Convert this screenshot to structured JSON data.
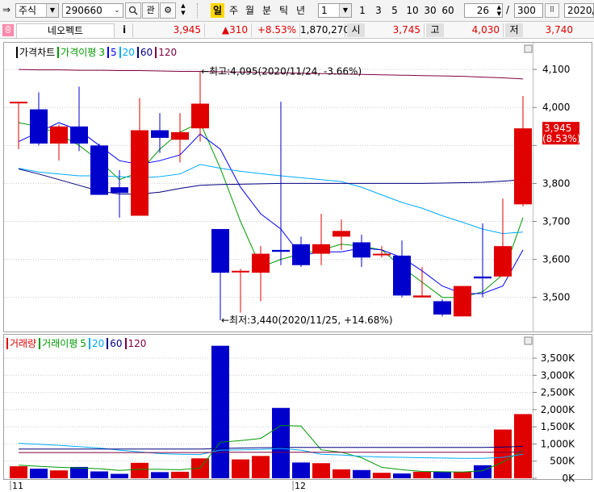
{
  "toolbar": {
    "market": "주식",
    "code": "290660",
    "watch_label": "관",
    "period_buttons": [
      "일",
      "주",
      "월",
      "분",
      "틱",
      "년"
    ],
    "interval_value": "1",
    "minute_buttons": [
      "1",
      "3",
      "5",
      "10",
      "30",
      "60"
    ],
    "count_value": "26",
    "slash": "/",
    "total_value": "300",
    "date_value": "2020/"
  },
  "info": {
    "stock_name": "네오펙트",
    "info_label": "i",
    "price": "3,945",
    "change": "▲310",
    "change_pct": "+8.53%",
    "volume": "1,870,270",
    "open_label": "시",
    "open": "3,745",
    "high_label": "고",
    "high": "4,030",
    "low_label": "저",
    "low": "3,740"
  },
  "price_legend": {
    "title": "가격차트",
    "ma_title": "가격이평",
    "ma_periods": [
      "3",
      "5",
      "20",
      "60",
      "120"
    ]
  },
  "volume_legend": {
    "title": "거래량",
    "ma_title": "거래이평",
    "ma_periods": [
      "5",
      "20",
      "60",
      "120"
    ]
  },
  "annotations": {
    "high": "←최고:4,095(2020/11/24, -3.66%)",
    "low": "←최저:3,440(2020/11/25, +14.68%)",
    "current_price": "3,945",
    "current_pct": "(8.53%)"
  },
  "x_labels": [
    {
      "label": "11",
      "index": 0
    },
    {
      "label": "12",
      "index": 14
    }
  ],
  "colors": {
    "up": "#e00000",
    "down": "#0000cc",
    "ma3": "#009900",
    "ma5": "#0000ff",
    "ma20": "#00aaff",
    "ma60": "#000080",
    "ma120": "#800040"
  },
  "chart_data": {
    "type": "candlestick",
    "price": {
      "ylim": [
        3440,
        4130
      ],
      "yticks": [
        3500,
        3600,
        3700,
        3800,
        3900,
        4000,
        4100
      ],
      "ytick_labels": [
        "3,500",
        "3,600",
        "3,700",
        "3,800",
        "",
        "4,000",
        "4,100"
      ],
      "candles": [
        {
          "o": 4015,
          "h": 4015,
          "l": 3890,
          "c": 4015
        },
        {
          "o": 3995,
          "h": 4040,
          "l": 3900,
          "c": 3905
        },
        {
          "o": 3905,
          "h": 3955,
          "l": 3860,
          "c": 3950
        },
        {
          "o": 3950,
          "h": 4055,
          "l": 3885,
          "c": 3905
        },
        {
          "o": 3900,
          "h": 3905,
          "l": 3770,
          "c": 3770
        },
        {
          "o": 3790,
          "h": 3835,
          "l": 3710,
          "c": 3775
        },
        {
          "o": 3715,
          "h": 4025,
          "l": 3715,
          "c": 3940
        },
        {
          "o": 3940,
          "h": 3985,
          "l": 3880,
          "c": 3920
        },
        {
          "o": 3915,
          "h": 3985,
          "l": 3855,
          "c": 3935
        },
        {
          "o": 3945,
          "h": 4095,
          "l": 3910,
          "c": 4010
        },
        {
          "o": 3680,
          "h": 3680,
          "l": 3440,
          "c": 3565
        },
        {
          "o": 3570,
          "h": 3575,
          "l": 3460,
          "c": 3570
        },
        {
          "o": 3565,
          "h": 3635,
          "l": 3490,
          "c": 3615
        },
        {
          "o": 3625,
          "h": 4015,
          "l": 3585,
          "c": 3620
        },
        {
          "o": 3640,
          "h": 3660,
          "l": 3580,
          "c": 3585
        },
        {
          "o": 3615,
          "h": 3720,
          "l": 3585,
          "c": 3640
        },
        {
          "o": 3660,
          "h": 3705,
          "l": 3625,
          "c": 3675
        },
        {
          "o": 3645,
          "h": 3665,
          "l": 3580,
          "c": 3605
        },
        {
          "o": 3615,
          "h": 3635,
          "l": 3605,
          "c": 3615
        },
        {
          "o": 3610,
          "h": 3650,
          "l": 3500,
          "c": 3505
        },
        {
          "o": 3500,
          "h": 3580,
          "l": 3500,
          "c": 3505
        },
        {
          "o": 3490,
          "h": 3495,
          "l": 3450,
          "c": 3455
        },
        {
          "o": 3450,
          "h": 3525,
          "l": 3450,
          "c": 3530
        },
        {
          "o": 3555,
          "h": 3695,
          "l": 3500,
          "c": 3550
        },
        {
          "o": 3555,
          "h": 3760,
          "l": 3555,
          "c": 3635
        },
        {
          "o": 3745,
          "h": 4030,
          "l": 3740,
          "c": 3945
        }
      ],
      "ma": [
        {
          "name": "3",
          "color": "#009900",
          "values": [
            3960,
            3950,
            3930,
            3900,
            3860,
            3810,
            3830,
            3890,
            3935,
            3960,
            3840,
            3700,
            3580,
            3600,
            3615,
            3625,
            3640,
            3635,
            3625,
            3580,
            3540,
            3500,
            3500,
            3515,
            3560,
            3710
          ]
        },
        {
          "name": "5",
          "color": "#0000ff",
          "values": [
            3910,
            3935,
            3960,
            3940,
            3900,
            3860,
            3850,
            3860,
            3875,
            3930,
            3890,
            3790,
            3720,
            3680,
            3610,
            3620,
            3620,
            3630,
            3625,
            3605,
            3570,
            3530,
            3510,
            3510,
            3530,
            3625
          ]
        },
        {
          "name": "20",
          "color": "#00aaff",
          "values": [
            3840,
            3830,
            3825,
            3820,
            3820,
            3818,
            3815,
            3818,
            3825,
            3850,
            3840,
            3832,
            3826,
            3820,
            3815,
            3810,
            3805,
            3790,
            3770,
            3750,
            3735,
            3715,
            3698,
            3680,
            3668,
            3672
          ]
        },
        {
          "name": "60",
          "color": "#000080",
          "values": [
            3838,
            3825,
            3810,
            3795,
            3780,
            3772,
            3772,
            3777,
            3787,
            3795,
            3797,
            3798,
            3799,
            3800,
            3800,
            3800,
            3800,
            3800,
            3800,
            3800,
            3800,
            3801,
            3802,
            3803,
            3806,
            3810
          ]
        },
        {
          "name": "120",
          "color": "#800040",
          "values": [
            4100,
            4099,
            4099,
            4098,
            4098,
            4097,
            4097,
            4096,
            4095,
            4095,
            4094,
            4093,
            4092,
            4091,
            4090,
            4089,
            4088,
            4087,
            4086,
            4085,
            4084,
            4083,
            4082,
            4080,
            4078,
            4075
          ]
        }
      ]
    },
    "volume": {
      "ylim": [
        0,
        3900000
      ],
      "yticks": [
        0,
        500000,
        1000000,
        1500000,
        2000000,
        2500000,
        3000000,
        3500000
      ],
      "ytick_labels": [
        "0K",
        "500K",
        "1,000K",
        "1,500K",
        "2,000K",
        "2,500K",
        "3,000K",
        "3,500K"
      ],
      "values": [
        350000,
        280000,
        230000,
        330000,
        200000,
        130000,
        450000,
        180000,
        190000,
        580000,
        3860000,
        550000,
        650000,
        2050000,
        460000,
        440000,
        260000,
        240000,
        160000,
        140000,
        190000,
        190000,
        190000,
        380000,
        1420000,
        1870000
      ],
      "ma": [
        {
          "name": "5",
          "color": "#009900",
          "values": [
            380000,
            350000,
            320000,
            300000,
            280000,
            230000,
            260000,
            260000,
            250000,
            300000,
            1050000,
            1100000,
            1160000,
            1540000,
            1520000,
            830000,
            760000,
            600000,
            320000,
            250000,
            200000,
            190000,
            180000,
            220000,
            470000,
            810000
          ]
        },
        {
          "name": "20",
          "color": "#00aaff",
          "values": [
            1020000,
            990000,
            960000,
            920000,
            880000,
            820000,
            770000,
            720000,
            700000,
            690000,
            820000,
            830000,
            840000,
            870000,
            820000,
            700000,
            680000,
            640000,
            620000,
            610000,
            600000,
            590000,
            580000,
            580000,
            610000,
            700000
          ]
        },
        {
          "name": "60",
          "color": "#000080",
          "values": [
            850000,
            850000,
            850000,
            850000,
            850000,
            850000,
            850000,
            850000,
            850000,
            850000,
            870000,
            880000,
            890000,
            900000,
            900000,
            900000,
            900000,
            900000,
            900000,
            900000,
            900000,
            900000,
            900000,
            900000,
            910000,
            930000
          ]
        },
        {
          "name": "120",
          "color": "#800040",
          "values": [
            750000,
            750000,
            750000,
            750000,
            750000,
            750000,
            750000,
            750000,
            750000,
            750000,
            760000,
            760000,
            760000,
            760000,
            760000,
            760000,
            760000,
            760000,
            760000,
            760000,
            760000,
            760000,
            760000,
            760000,
            760000,
            770000
          ]
        }
      ]
    }
  }
}
